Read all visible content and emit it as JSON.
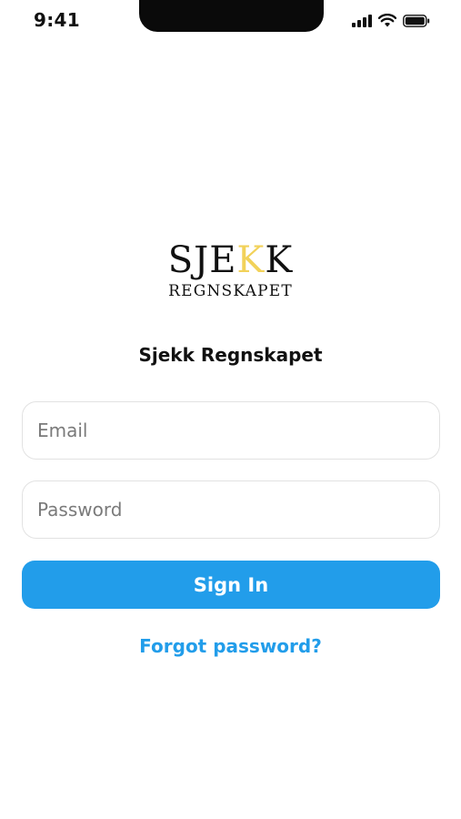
{
  "status_bar": {
    "time": "9:41",
    "icons": [
      "cellular-signal-icon",
      "wifi-icon",
      "battery-icon"
    ]
  },
  "logo": {
    "main_prefix": "SJE",
    "main_accent": "K",
    "main_suffix": "K",
    "subtitle": "REGNSKAPET"
  },
  "heading": {
    "title": "Sjekk Regnskapet"
  },
  "form": {
    "email_placeholder": "Email",
    "email_value": "",
    "password_placeholder": "Password",
    "password_value": "",
    "sign_in_label": "Sign In",
    "forgot_label": "Forgot password?"
  },
  "colors": {
    "accent": "#229dea",
    "logo_accent": "#f2d25a",
    "text": "#111111",
    "placeholder": "#7a7a7a",
    "field_border": "#e2e2e2"
  }
}
